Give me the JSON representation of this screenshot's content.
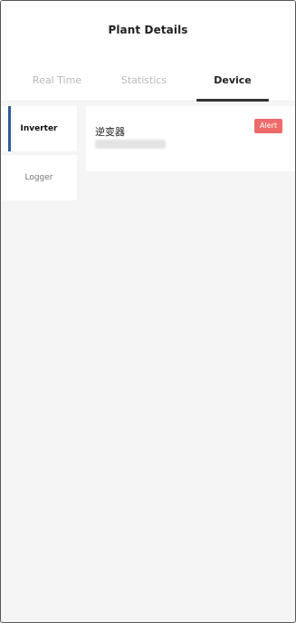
{
  "header": {
    "title": "Plant Details"
  },
  "tabs": [
    {
      "label": "Real Time",
      "active": false
    },
    {
      "label": "Statistics",
      "active": false
    },
    {
      "label": "Device",
      "active": true
    }
  ],
  "side_nav": {
    "items": [
      {
        "label": "Inverter",
        "active": true
      },
      {
        "label": "Logger",
        "active": false
      }
    ]
  },
  "device_card": {
    "title": "逆变器",
    "status_badge": "Alert"
  },
  "colors": {
    "accent": "#2f5d9c",
    "alert": "#ef6b6b",
    "page_bg": "#f5f5f5"
  }
}
